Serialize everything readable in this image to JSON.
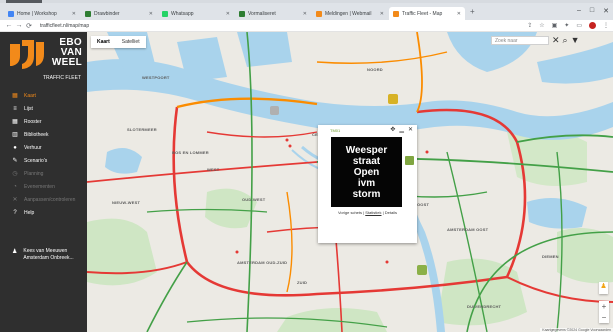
{
  "browser": {
    "tabs": [
      {
        "label": "Home | Workshop",
        "color": "#4285f4",
        "active": false
      },
      {
        "label": "Drawbinder",
        "color": "#2e7d32",
        "active": false
      },
      {
        "label": "Whatsapp",
        "color": "#25d366",
        "active": false
      },
      {
        "label": "Vormaliseret",
        "color": "#2e7d32",
        "active": false
      },
      {
        "label": "Meldingen | Webmail",
        "color": "#f28a1a",
        "active": false
      },
      {
        "label": "Traffic Fleet - Map",
        "color": "#f28a1a",
        "active": true
      }
    ],
    "new_tab": "+",
    "url": "trafficfleet.nl/map/map",
    "window_controls": [
      "–",
      "□",
      "✕"
    ]
  },
  "sidebar": {
    "logo": {
      "line1": "EBO",
      "line2": "VAN",
      "line3": "WEEL",
      "brand_color": "#f28a1a"
    },
    "product": "TRAFFIC FLEET",
    "items": [
      {
        "label": "Kaart",
        "icon": "map-icon",
        "glyph": "▦",
        "active": true,
        "dim": false
      },
      {
        "label": "Lijst",
        "icon": "list-icon",
        "glyph": "≡",
        "active": false,
        "dim": false
      },
      {
        "label": "Rooster",
        "icon": "grid-icon",
        "glyph": "▦",
        "active": false,
        "dim": false
      },
      {
        "label": "Bibliotheek",
        "icon": "library-icon",
        "glyph": "▥",
        "active": false,
        "dim": false
      },
      {
        "label": "Verhuur",
        "icon": "rental-icon",
        "glyph": "●",
        "active": false,
        "dim": false
      },
      {
        "label": "Scenario's",
        "icon": "scenario-icon",
        "glyph": "✎",
        "active": false,
        "dim": false
      },
      {
        "label": "Planning",
        "icon": "planning-icon",
        "glyph": "◷",
        "active": false,
        "dim": true
      },
      {
        "label": "Evenementen",
        "icon": "event-icon",
        "glyph": "◔",
        "active": false,
        "dim": true
      },
      {
        "label": "Aanpassen/controleren",
        "icon": "wrench-icon",
        "glyph": "✕",
        "active": false,
        "dim": true
      },
      {
        "label": "Help",
        "icon": "help-icon",
        "glyph": "?",
        "active": false,
        "dim": false
      }
    ],
    "user": {
      "name": "Kees van Meeuwen",
      "org": "Amsterdam Onbreek..."
    }
  },
  "map": {
    "type_buttons": [
      {
        "label": "Kaart",
        "selected": true
      },
      {
        "label": "Satelliet",
        "selected": false
      }
    ],
    "search_placeholder": "Zoek naar",
    "labels": [
      "WESTPOORT",
      "NOORD",
      "CENTRUM",
      "BOS EN LOMMER",
      "WEST",
      "OUD-WEST",
      "AMSTERDAM OUD-ZUID",
      "ZUID",
      "OOST",
      "AMSTERDAM OOST",
      "DIEMEN",
      "DUIVENDRECHT",
      "SLOTERMEER",
      "NIEUW-WEST"
    ],
    "popup": {
      "title": "TM01",
      "sign_lines": [
        "Weesper",
        "straat",
        "Open",
        "ivm",
        "storm"
      ],
      "links": [
        "Vorige schets",
        "Statistiek",
        "Details"
      ]
    },
    "zoom": [
      "+",
      "−"
    ],
    "footer": "Kaartgegevens ©2024 Google  Voorwaarden"
  }
}
